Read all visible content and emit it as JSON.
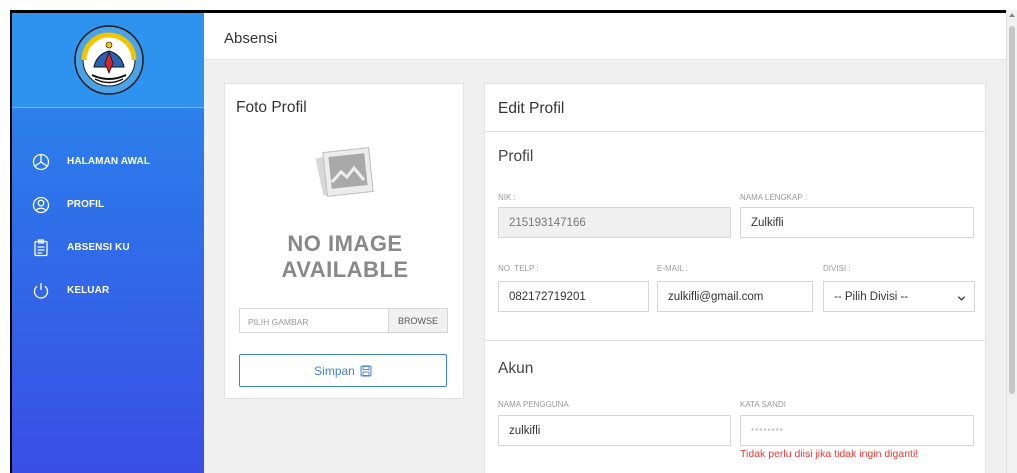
{
  "header": {
    "title": "Absensi"
  },
  "sidebar": {
    "items": [
      {
        "label": "HALAMAN AWAL",
        "icon": "pie-chart-icon"
      },
      {
        "label": "PROFIL",
        "icon": "user-icon"
      },
      {
        "label": "ABSENSI KU",
        "icon": "clipboard-icon"
      },
      {
        "label": "KELUAR",
        "icon": "power-icon"
      }
    ]
  },
  "photo": {
    "title": "Foto Profil",
    "noimage_line1": "NO IMAGE",
    "noimage_line2": "AVAILABLE",
    "file_placeholder": "PILIH GAMBAR",
    "browse_label": "BROWSE",
    "save_label": "Simpan"
  },
  "edit": {
    "title": "Edit Profil",
    "profil_section": "Profil",
    "akun_section": "Akun",
    "nik_label": "NIK :",
    "nik_value": "215193147166",
    "nama_label": "NAMA LENGKAP :",
    "nama_value": "Zulkifli",
    "telp_label": "NO. TELP :",
    "telp_value": "082172719201",
    "email_label": "E-MAIL :",
    "email_value": "zulkifli@gmail.com",
    "divisi_label": "DIVISI :",
    "divisi_value": "-- Pilih Divisi --",
    "username_label": "NAMA PENGGUNA",
    "username_value": "zulkifli",
    "password_label": "KATA SANDI",
    "password_value": "********",
    "password_hint": "Tidak perlu diisi jika tidak ingin diganti!"
  },
  "colors": {
    "sidebar_top": "#2a8ef0",
    "sidebar_bottom": "#3a4ee6",
    "accent": "#3f7fe0",
    "hint_red": "#e53935"
  }
}
